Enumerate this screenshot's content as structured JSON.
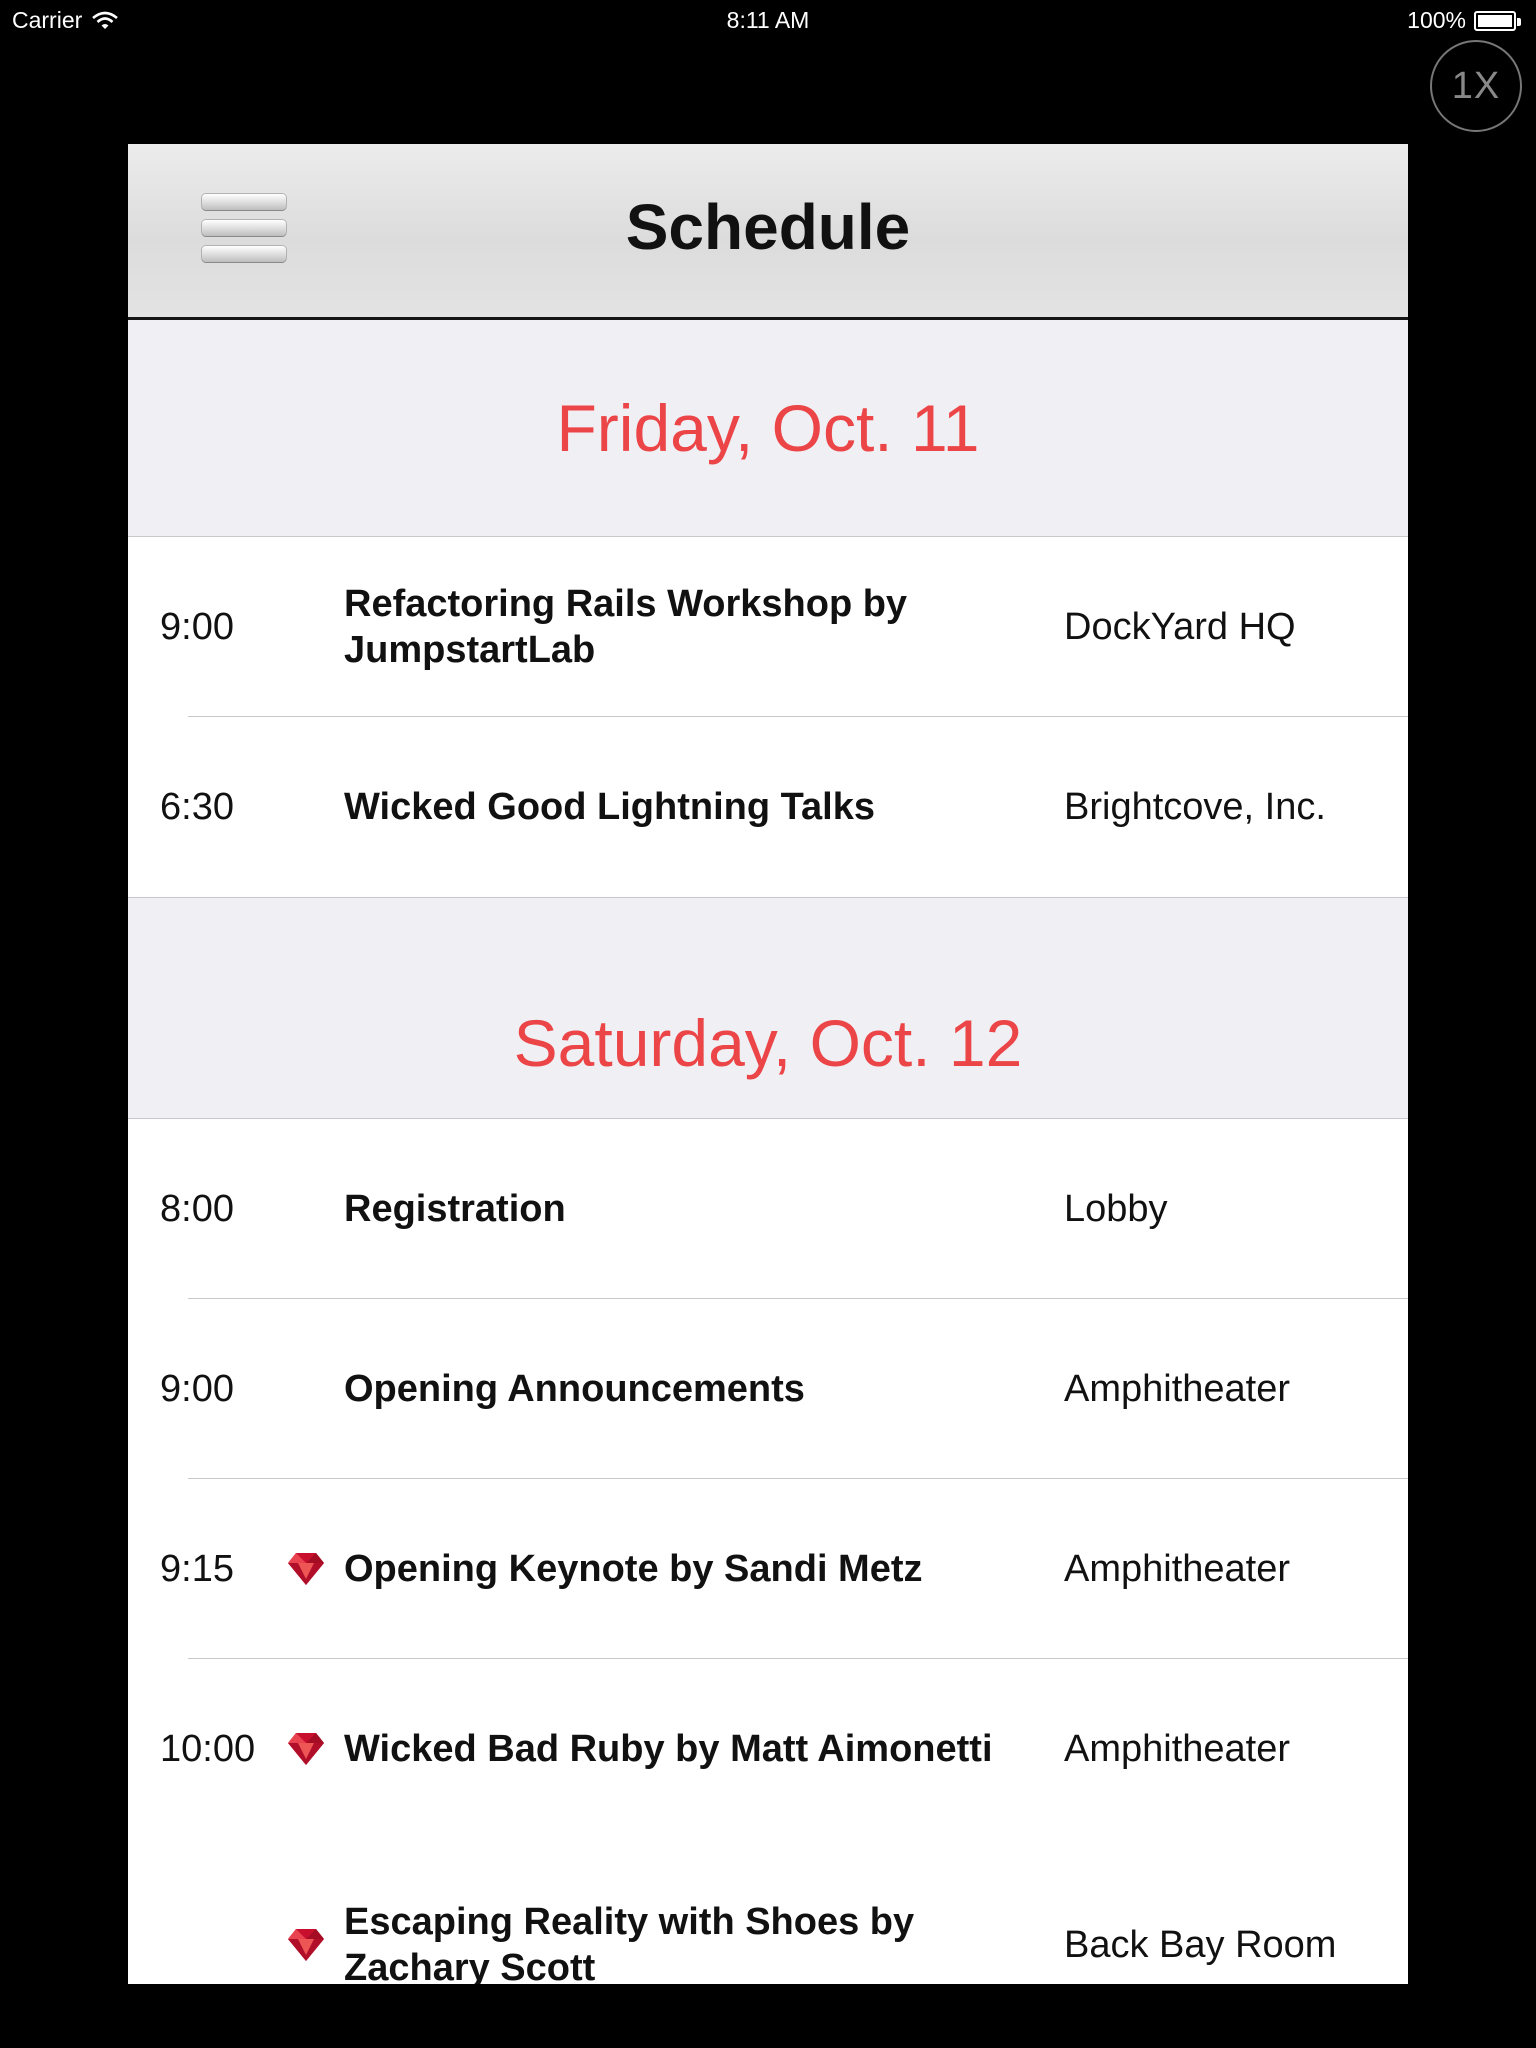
{
  "status_bar": {
    "carrier": "Carrier",
    "time": "8:11 AM",
    "battery": "100%"
  },
  "zoom_button": {
    "label": "1X"
  },
  "navbar": {
    "title": "Schedule"
  },
  "sections": [
    {
      "header": "Friday, Oct. 11",
      "rows": [
        {
          "time": "9:00",
          "title": "Refactoring Rails Workshop by JumpstartLab",
          "room": "DockYard HQ"
        },
        {
          "time": "6:30",
          "title": "Wicked Good Lightning Talks",
          "room": "Brightcove, Inc."
        }
      ]
    },
    {
      "header": "Saturday, Oct. 12",
      "rows": [
        {
          "time": "8:00",
          "title": "Registration",
          "room": "Lobby"
        },
        {
          "time": "9:00",
          "title": "Opening Announcements",
          "room": "Amphitheater"
        },
        {
          "time": "9:15",
          "icon": "ruby-icon",
          "title": "Opening Keynote by Sandi Metz",
          "room": "Amphitheater"
        },
        {
          "time": "10:00",
          "icon": "ruby-icon",
          "title": "Wicked Bad Ruby by Matt Aimonetti",
          "room": "Amphitheater"
        },
        {
          "time": "",
          "icon": "ruby-icon",
          "title": "Escaping Reality with Shoes by Zachary Scott",
          "room": "Back Bay Room"
        }
      ]
    }
  ],
  "colors": {
    "section_header_text": "#ec4547",
    "section_header_bg": "#efeff4",
    "ruby_red": "#c8102e"
  }
}
